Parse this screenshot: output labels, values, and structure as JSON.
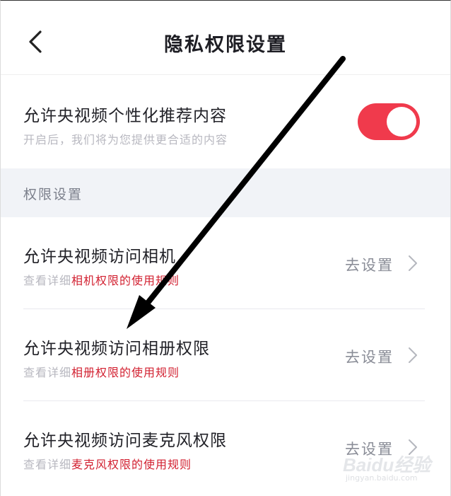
{
  "header": {
    "title": "隐私权限设置",
    "back_icon": "chevron-left-icon"
  },
  "personalization": {
    "title": "允许央视频个性化推荐内容",
    "subtitle": "开启后，我们将为您提供更合适的内容",
    "toggle_on": true,
    "toggle_color": "#f03a4c"
  },
  "section": {
    "label": "权限设置"
  },
  "permissions": [
    {
      "title": "允许央视频访问相机",
      "sub_prefix": "查看详细",
      "sub_link": "相机权限的使用规则",
      "action": "去设置"
    },
    {
      "title": "允许央视频访问相册权限",
      "sub_prefix": "查看详细",
      "sub_link": "相册权限的使用规则",
      "action": "去设置"
    },
    {
      "title": "允许央视频访问麦克风权限",
      "sub_prefix": "查看详细",
      "sub_link": "麦克风权限的使用规则",
      "action": "去设置"
    }
  ],
  "colors": {
    "accent": "#f03a4c",
    "link_red": "#d22030",
    "section_bg": "#f1f3f7"
  },
  "watermark": {
    "logo": "Baidu经验",
    "url": "jingyan.baidu.com"
  }
}
